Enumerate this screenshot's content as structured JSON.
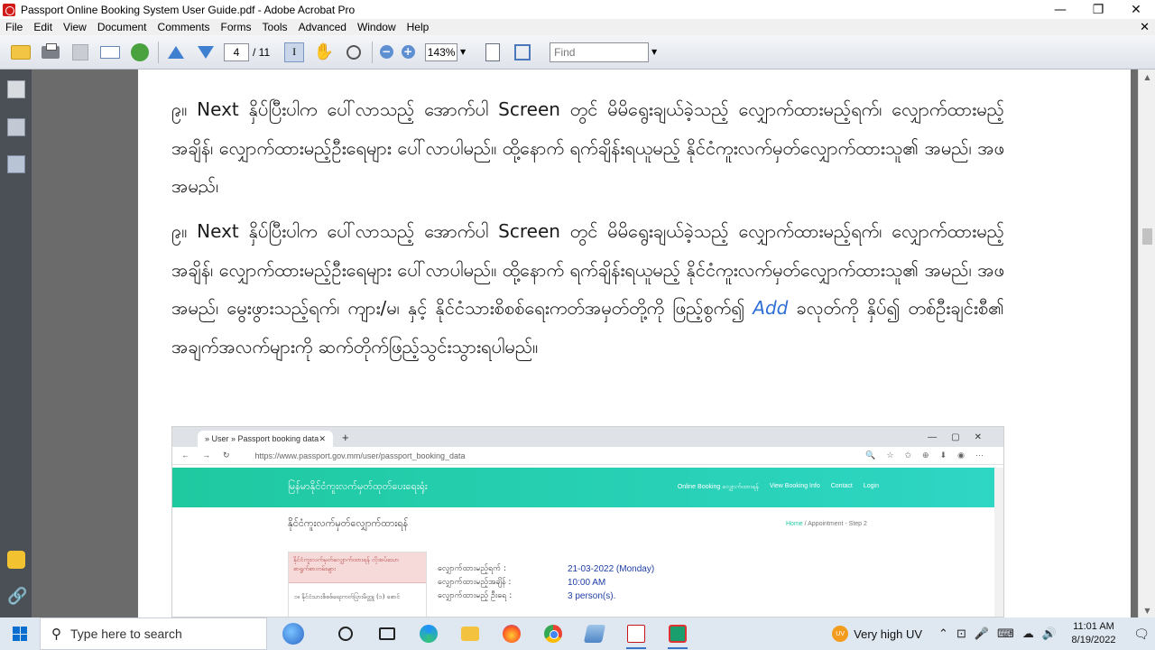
{
  "window": {
    "title": "Passport Online Booking System User Guide.pdf - Adobe Acrobat Pro",
    "minimize_glyph": "—",
    "restore_glyph": "❐",
    "close_glyph": "✕"
  },
  "menu": {
    "items": [
      "File",
      "Edit",
      "View",
      "Document",
      "Comments",
      "Forms",
      "Tools",
      "Advanced",
      "Window",
      "Help"
    ],
    "close_doc_glyph": "✕"
  },
  "toolbar": {
    "icons": [
      "open-folder-icon",
      "print-icon",
      "save-icon",
      "email-icon",
      "collaborate-icon",
      "previous-page-icon",
      "next-page-icon",
      "select-text-icon",
      "hand-tool-icon",
      "marquee-zoom-icon",
      "zoom-out-icon",
      "zoom-in-icon",
      "fit-page-icon",
      "full-screen-icon"
    ],
    "current_page": "4",
    "page_total": "/ 11",
    "zoom": "143%",
    "find_placeholder": "Find",
    "select_text_glyph": "I",
    "hand_glyph": "✋",
    "zoom_out_glyph": "−",
    "zoom_in_glyph": "+",
    "dropdown_glyph": "▼"
  },
  "document": {
    "para1": "၉။ Next နှိပ်ပြီးပါက ပေါ်လာသည့် အောက်ပါ Screen တွင် မိမိရွေးချယ်ခဲ့သည့် လျှောက်ထားမည့်ရက်၊ လျှောက်ထားမည့်အချိန်၊ လျှောက်ထားမည့်ဦးရေများ ပေါ်လာပါမည်။ ထို့နောက် ရက်ချိန်းရယူမည့် နိုင်ငံကူးလက်မှတ်လျှောက်ထားသူ၏ အမည်၊ အဖအမည်၊",
    "para2_before_link": "၉။ Next နှိပ်ပြီးပါက ပေါ်လာသည့် အောက်ပါ Screen တွင် မိမိရွေးချယ်ခဲ့သည့် လျှောက်ထားမည့်ရက်၊ လျှောက်ထားမည့်အချိန်၊ လျှောက်ထားမည့်ဦးရေများ ပေါ်လာပါမည်။ ထို့နောက် ရက်ချိန်းရယူမည့် နိုင်ငံကူးလက်မှတ်လျှောက်ထားသူ၏ အမည်၊ အဖအမည်၊ မွေးဖွားသည့်ရက်၊ ကျား/မ၊ နှင့် နိုင်ငံသားစိစစ်ရေးကတ်အမှတ်တို့ကို ဖြည့်စွက်၍ ",
    "para2_link": "Add",
    "para2_after_link": " ခလုတ်ကို နှိပ်၍ တစ်ဦးချင်းစီ၏ အချက်အလက်များကို ဆက်တိုက်ဖြည့်သွင်းသွားရပါမည်။"
  },
  "screenshot": {
    "tab_title": "» User » Passport booking data",
    "tab_close": "✕",
    "new_tab": "+",
    "window_controls": "—▢✕",
    "nav_buttons": "←→↻",
    "url": "https://www.passport.gov.mm/user/passport_booking_data",
    "address_icons": "🔍☆✩⊕⬇◉⋯",
    "site_logo": "မြန်မာနိုင်ငံကူးလက်မှတ်ထုတ်ပေးရေးရုံး",
    "site_nav": [
      "Online Booking လျှောက်ထားရန်",
      "View Booking Info",
      "Contact",
      "Login"
    ],
    "page_heading": "နိုင်ငံကူးလက်မှတ်လျှောက်ထားရန်",
    "breadcrumb_home": "Home",
    "breadcrumb_sep": " / ",
    "breadcrumb_current": "Appointment - Step 2",
    "card_header": "နိုင်ငံကူးလက်မှတ်လျှောက်ထားရန် လိုအပ်သောစာရွက်စာတမ်းများ",
    "card_item": "၁။ နိုင်ငံသားစိစစ်ရေးကတ်ပြားမိတ္တူ (၁) စောင်",
    "info": [
      {
        "label": "လျှောက်ထားမည့်ရက် :",
        "value": "21-03-2022 (Monday)"
      },
      {
        "label": "လျှောက်ထားမည့်အချိန် :",
        "value": "10:00 AM"
      },
      {
        "label": "လျှောက်ထားမည့် ဦးရေ :",
        "value": "3 person(s)."
      }
    ]
  },
  "scrollbar": {
    "up_glyph": "▲",
    "down_glyph": "▼"
  },
  "taskbar": {
    "search_placeholder": "Type here to search",
    "search_glyph": "⚲",
    "apps": [
      "cortana-icon",
      "task-view-icon",
      "edge-icon",
      "file-explorer-icon",
      "firefox-icon",
      "chrome-icon",
      "tool-icon",
      "acrobat-icon",
      "screen-recorder-icon"
    ],
    "weather_badge": "UV",
    "weather": "Very high UV",
    "tray_glyphs": [
      "⌃",
      "⊡",
      "🎤",
      "⌨",
      "☁",
      "🔊"
    ],
    "time": "11:01 AM",
    "date": "8/19/2022",
    "notification_glyph": "🗨"
  }
}
